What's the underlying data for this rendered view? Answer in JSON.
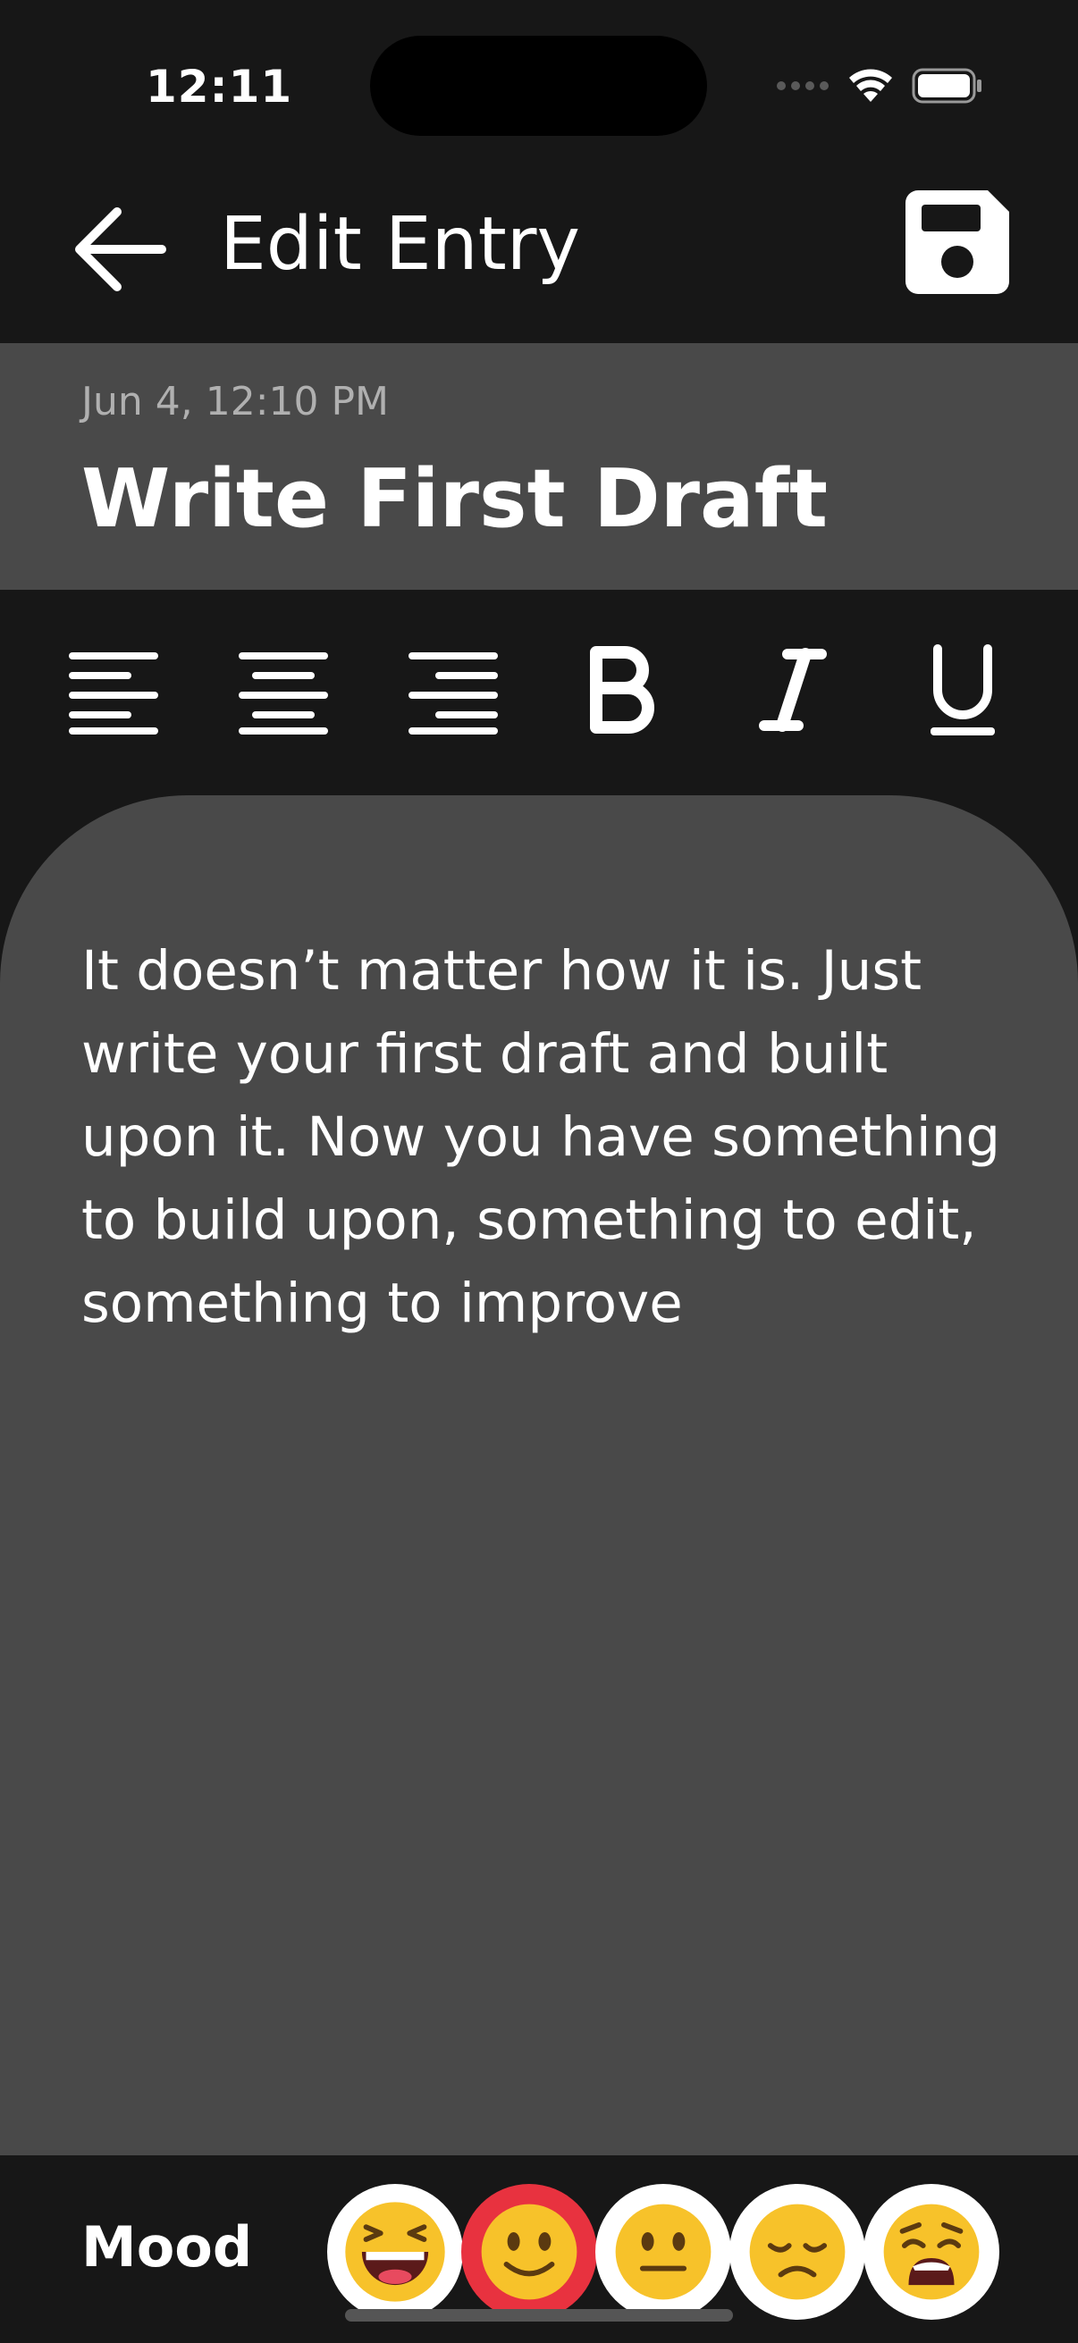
{
  "status_bar": {
    "time": "12:11"
  },
  "header": {
    "title": "Edit Entry",
    "back_icon": "arrow-left-icon",
    "save_icon": "floppy-disk-icon"
  },
  "entry": {
    "date": "Jun 4, 12:10 PM",
    "title": "Write First Draft",
    "body": "It doesn’t matter how it is. Just write your first draft and built upon it. Now you have something to build upon, something to edit, something to improve"
  },
  "toolbar": {
    "tools": [
      "align-left-icon",
      "align-center-icon",
      "align-right-icon",
      "bold-icon",
      "italic-icon",
      "underline-icon"
    ]
  },
  "mood": {
    "label": "Mood",
    "options": [
      "laughing",
      "smiling",
      "neutral",
      "sad",
      "weary"
    ],
    "selected": "smiling",
    "selected_color": "#e8323f"
  },
  "colors": {
    "background": "#171717",
    "panel": "#494949",
    "text": "#ffffff",
    "muted": "#b0b0b0"
  }
}
